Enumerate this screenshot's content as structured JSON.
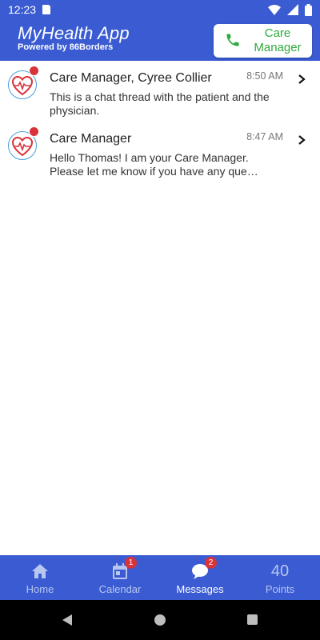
{
  "status_bar": {
    "time": "12:23",
    "icons": [
      "sd-card-icon",
      "wifi-icon",
      "signal-icon",
      "battery-icon"
    ]
  },
  "header": {
    "title": "MyHealth App",
    "subtitle": "Powered by 86Borders",
    "care_manager_button": {
      "label": "Care Manager",
      "icon": "phone-icon"
    }
  },
  "messages": [
    {
      "sender": "Care Manager, Cyree Collier",
      "time": "8:50 AM",
      "preview": "This is a chat thread with the patient and the physician.",
      "unread": true,
      "avatar_icon": "heart-pulse-icon"
    },
    {
      "sender": "Care Manager",
      "time": "8:47 AM",
      "preview": "Hello Thomas! I am your Care Manager. Please let me know if you have any que…",
      "unread": true,
      "avatar_icon": "heart-pulse-icon"
    }
  ],
  "bottom_nav": {
    "items": [
      {
        "label": "Home",
        "icon": "home-icon",
        "badge": ""
      },
      {
        "label": "Calendar",
        "icon": "calendar-icon",
        "badge": "1"
      },
      {
        "label": "Messages",
        "icon": "chat-bubble-icon",
        "badge": "2",
        "active": true
      },
      {
        "label": "Points",
        "value": "40"
      }
    ]
  },
  "colors": {
    "brand_blue": "#3a5bd1",
    "green": "#2eaa3e",
    "badge_red": "#d93238"
  }
}
